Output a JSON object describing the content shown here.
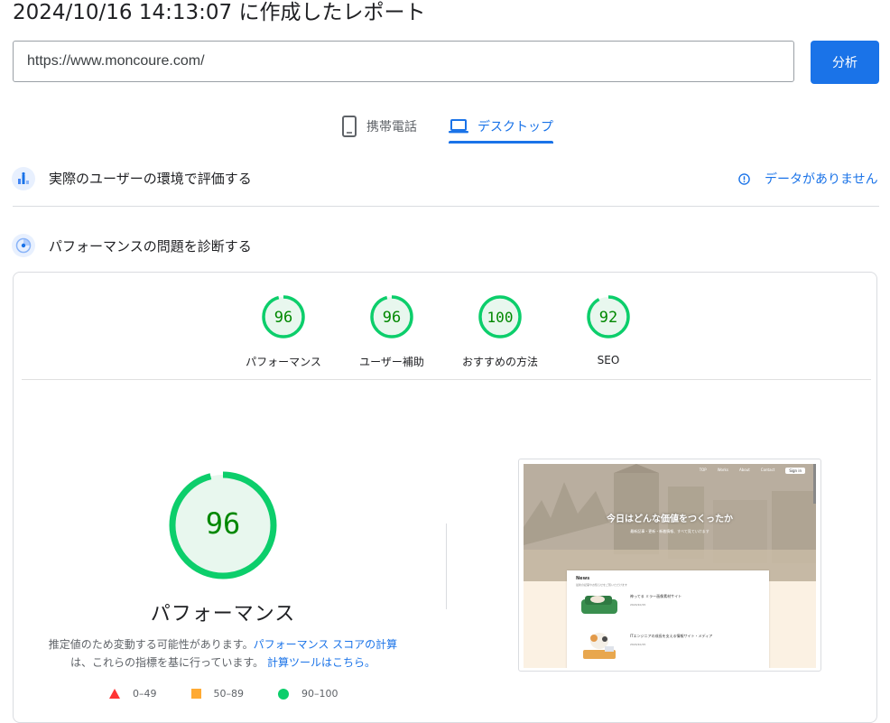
{
  "header": {
    "title": "2024/10/16 14:13:07 に作成したレポート"
  },
  "url_bar": {
    "value": "https://www.moncoure.com/",
    "analyze_label": "分析"
  },
  "tabs": [
    {
      "label": "携帯電話",
      "icon": "mobile-phone-icon",
      "selected": false
    },
    {
      "label": "デスクトップ",
      "icon": "laptop-icon",
      "selected": true
    }
  ],
  "field_data": {
    "title": "実際のユーザーの環境で評価する",
    "no_data_label": "データがありません"
  },
  "diagnose": {
    "title": "パフォーマンスの問題を診断する"
  },
  "scores": [
    {
      "label": "パフォーマンス",
      "value": 96
    },
    {
      "label": "ユーザー補助",
      "value": 96
    },
    {
      "label": "おすすめの方法",
      "value": 100
    },
    {
      "label": "SEO",
      "value": 92
    }
  ],
  "performance": {
    "score": 96,
    "title": "パフォーマンス",
    "desc_part1": "推定値のため変動する可能性があります。",
    "desc_link1": "パフォーマンス スコアの計算",
    "desc_part2": "は、これらの指標を基に行っています。",
    "desc_link2": "計算ツールはこちら。"
  },
  "legend": [
    {
      "range": "0–49",
      "color": "#ff3333",
      "shape": "triangle"
    },
    {
      "range": "50–89",
      "color": "#ffaa33",
      "shape": "square"
    },
    {
      "range": "90–100",
      "color": "#0cce6b",
      "shape": "circle"
    }
  ],
  "colors": {
    "accent": "#1a73e8",
    "pass": "#0cce6b",
    "pass_bg": "#e8f7ee",
    "pass_text": "#008800"
  },
  "thumbnail": {
    "nav": [
      "TOP",
      "Works",
      "About",
      "Contact"
    ],
    "signin": "Sign in",
    "headline": "今日はどんな価値をつくったか",
    "subline": "最新記事・更新・新着情報、すべて見ていけます",
    "news_title": "News",
    "news_sub": "最新の記事やお知らせをご覧いただけます",
    "items": [
      {
        "text": "神ってる ミラー画像素材サイト",
        "date": "2024/10/15"
      },
      {
        "text": "ITエンジニアの成長を支える情報サイト・メディア",
        "date": "2024/10/15"
      }
    ]
  }
}
